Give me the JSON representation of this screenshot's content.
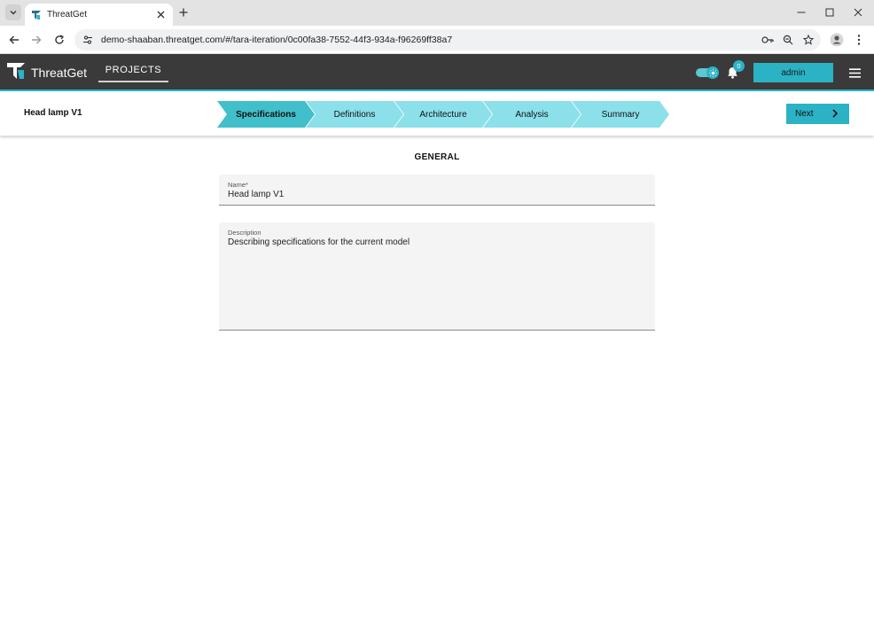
{
  "browser": {
    "tab_title": "ThreatGet",
    "url": "demo-shaaban.threatget.com/#/tara-iteration/0c00fa38-7552-44f3-934a-f96269ff38a7"
  },
  "app": {
    "brand": "ThreatGet",
    "nav_projects": "PROJECTS",
    "notification_count": "0",
    "user_button": "admin",
    "accent_color": "#2bb3c5"
  },
  "stepper": {
    "model_name": "Head lamp V1",
    "steps": [
      {
        "label": "Specifications",
        "active": true
      },
      {
        "label": "Definitions",
        "active": false
      },
      {
        "label": "Architecture",
        "active": false
      },
      {
        "label": "Analysis",
        "active": false
      },
      {
        "label": "Summary",
        "active": false
      }
    ],
    "next_label": "Next"
  },
  "form": {
    "section_title": "GENERAL",
    "name_label": "Name*",
    "name_value": "Head lamp V1",
    "description_label": "Description",
    "description_value": "Describing specifications for the current model"
  }
}
